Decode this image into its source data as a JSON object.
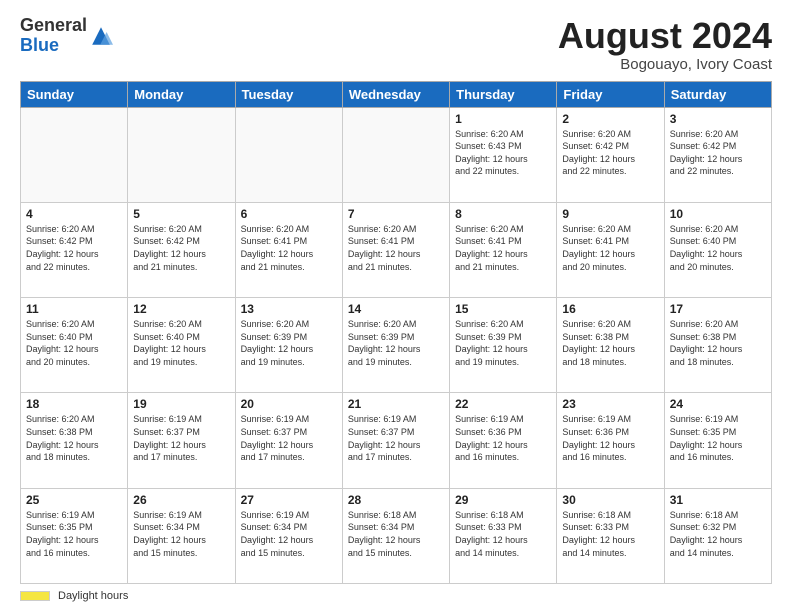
{
  "header": {
    "logo_general": "General",
    "logo_blue": "Blue",
    "month_title": "August 2024",
    "location": "Bogouayo, Ivory Coast"
  },
  "weekdays": [
    "Sunday",
    "Monday",
    "Tuesday",
    "Wednesday",
    "Thursday",
    "Friday",
    "Saturday"
  ],
  "footer": {
    "daylight_label": "Daylight hours"
  },
  "weeks": [
    [
      {
        "day": "",
        "info": ""
      },
      {
        "day": "",
        "info": ""
      },
      {
        "day": "",
        "info": ""
      },
      {
        "day": "",
        "info": ""
      },
      {
        "day": "1",
        "info": "Sunrise: 6:20 AM\nSunset: 6:43 PM\nDaylight: 12 hours\nand 22 minutes."
      },
      {
        "day": "2",
        "info": "Sunrise: 6:20 AM\nSunset: 6:42 PM\nDaylight: 12 hours\nand 22 minutes."
      },
      {
        "day": "3",
        "info": "Sunrise: 6:20 AM\nSunset: 6:42 PM\nDaylight: 12 hours\nand 22 minutes."
      }
    ],
    [
      {
        "day": "4",
        "info": "Sunrise: 6:20 AM\nSunset: 6:42 PM\nDaylight: 12 hours\nand 22 minutes."
      },
      {
        "day": "5",
        "info": "Sunrise: 6:20 AM\nSunset: 6:42 PM\nDaylight: 12 hours\nand 21 minutes."
      },
      {
        "day": "6",
        "info": "Sunrise: 6:20 AM\nSunset: 6:41 PM\nDaylight: 12 hours\nand 21 minutes."
      },
      {
        "day": "7",
        "info": "Sunrise: 6:20 AM\nSunset: 6:41 PM\nDaylight: 12 hours\nand 21 minutes."
      },
      {
        "day": "8",
        "info": "Sunrise: 6:20 AM\nSunset: 6:41 PM\nDaylight: 12 hours\nand 21 minutes."
      },
      {
        "day": "9",
        "info": "Sunrise: 6:20 AM\nSunset: 6:41 PM\nDaylight: 12 hours\nand 20 minutes."
      },
      {
        "day": "10",
        "info": "Sunrise: 6:20 AM\nSunset: 6:40 PM\nDaylight: 12 hours\nand 20 minutes."
      }
    ],
    [
      {
        "day": "11",
        "info": "Sunrise: 6:20 AM\nSunset: 6:40 PM\nDaylight: 12 hours\nand 20 minutes."
      },
      {
        "day": "12",
        "info": "Sunrise: 6:20 AM\nSunset: 6:40 PM\nDaylight: 12 hours\nand 19 minutes."
      },
      {
        "day": "13",
        "info": "Sunrise: 6:20 AM\nSunset: 6:39 PM\nDaylight: 12 hours\nand 19 minutes."
      },
      {
        "day": "14",
        "info": "Sunrise: 6:20 AM\nSunset: 6:39 PM\nDaylight: 12 hours\nand 19 minutes."
      },
      {
        "day": "15",
        "info": "Sunrise: 6:20 AM\nSunset: 6:39 PM\nDaylight: 12 hours\nand 19 minutes."
      },
      {
        "day": "16",
        "info": "Sunrise: 6:20 AM\nSunset: 6:38 PM\nDaylight: 12 hours\nand 18 minutes."
      },
      {
        "day": "17",
        "info": "Sunrise: 6:20 AM\nSunset: 6:38 PM\nDaylight: 12 hours\nand 18 minutes."
      }
    ],
    [
      {
        "day": "18",
        "info": "Sunrise: 6:20 AM\nSunset: 6:38 PM\nDaylight: 12 hours\nand 18 minutes."
      },
      {
        "day": "19",
        "info": "Sunrise: 6:19 AM\nSunset: 6:37 PM\nDaylight: 12 hours\nand 17 minutes."
      },
      {
        "day": "20",
        "info": "Sunrise: 6:19 AM\nSunset: 6:37 PM\nDaylight: 12 hours\nand 17 minutes."
      },
      {
        "day": "21",
        "info": "Sunrise: 6:19 AM\nSunset: 6:37 PM\nDaylight: 12 hours\nand 17 minutes."
      },
      {
        "day": "22",
        "info": "Sunrise: 6:19 AM\nSunset: 6:36 PM\nDaylight: 12 hours\nand 16 minutes."
      },
      {
        "day": "23",
        "info": "Sunrise: 6:19 AM\nSunset: 6:36 PM\nDaylight: 12 hours\nand 16 minutes."
      },
      {
        "day": "24",
        "info": "Sunrise: 6:19 AM\nSunset: 6:35 PM\nDaylight: 12 hours\nand 16 minutes."
      }
    ],
    [
      {
        "day": "25",
        "info": "Sunrise: 6:19 AM\nSunset: 6:35 PM\nDaylight: 12 hours\nand 16 minutes."
      },
      {
        "day": "26",
        "info": "Sunrise: 6:19 AM\nSunset: 6:34 PM\nDaylight: 12 hours\nand 15 minutes."
      },
      {
        "day": "27",
        "info": "Sunrise: 6:19 AM\nSunset: 6:34 PM\nDaylight: 12 hours\nand 15 minutes."
      },
      {
        "day": "28",
        "info": "Sunrise: 6:18 AM\nSunset: 6:34 PM\nDaylight: 12 hours\nand 15 minutes."
      },
      {
        "day": "29",
        "info": "Sunrise: 6:18 AM\nSunset: 6:33 PM\nDaylight: 12 hours\nand 14 minutes."
      },
      {
        "day": "30",
        "info": "Sunrise: 6:18 AM\nSunset: 6:33 PM\nDaylight: 12 hours\nand 14 minutes."
      },
      {
        "day": "31",
        "info": "Sunrise: 6:18 AM\nSunset: 6:32 PM\nDaylight: 12 hours\nand 14 minutes."
      }
    ]
  ]
}
